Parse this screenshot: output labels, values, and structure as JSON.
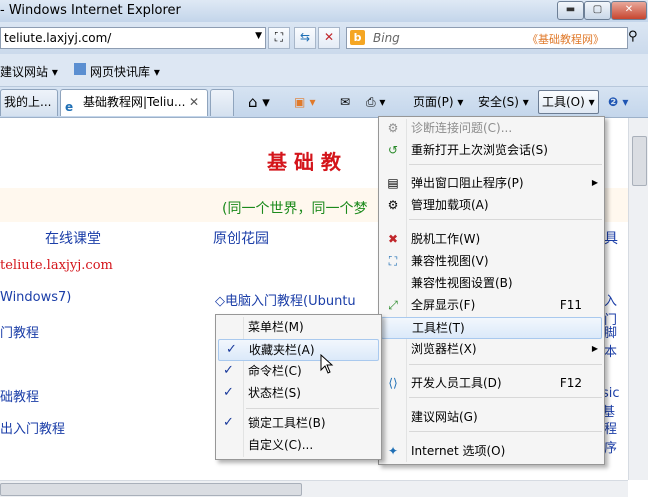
{
  "window": {
    "title": "- Windows Internet Explorer"
  },
  "address": {
    "url": "teliute.laxjyj.com/"
  },
  "search": {
    "provider": "Bing",
    "site_label": "《基础教程网》"
  },
  "favorites_bar": {
    "items": [
      "建议网站 ▾",
      "网页快讯库 ▾"
    ]
  },
  "tabs": [
    {
      "label": "我的上..."
    },
    {
      "label": "基础教程网|Teliu..."
    }
  ],
  "commands": {
    "page": "页面(P)",
    "safety": "安全(S)",
    "tools": "工具(O)"
  },
  "content": {
    "heading": "基  础  教",
    "subtitle": "(同一个世界，同一个梦",
    "nav": [
      "在线课堂",
      "原创花园",
      "具"
    ],
    "domain": "teliute.laxjyj.com",
    "rows": [
      "Windows7)",
      "◇电脑入门教程(Ubuntu",
      "入门",
      "门教程",
      "脚本",
      "础教程",
      "sic基",
      "出入门教程",
      "程序"
    ]
  },
  "tools_menu": {
    "items": [
      {
        "label": "诊断连接问题(C)...",
        "icon": "diagnose-icon",
        "disabled": true
      },
      {
        "label": "重新打开上次浏览会话(S)",
        "icon": "reopen-session-icon"
      },
      {
        "label": "弹出窗口阻止程序(P)",
        "icon": "popup-blocker-icon",
        "submenu": true
      },
      {
        "label": "管理加载项(A)",
        "icon": "addons-icon"
      },
      {
        "label": "脱机工作(W)",
        "icon": "offline-icon"
      },
      {
        "label": "兼容性视图(V)",
        "icon": "compat-view-icon"
      },
      {
        "label": "兼容性视图设置(B)"
      },
      {
        "label": "全屏显示(F)",
        "icon": "fullscreen-icon",
        "accel": "F11"
      },
      {
        "label": "工具栏(T)",
        "highlighted": true
      },
      {
        "label": "浏览器栏(X)",
        "submenu": true
      },
      {
        "label": "开发人员工具(D)",
        "icon": "dev-tools-icon",
        "accel": "F12"
      },
      {
        "label": "建议网站(G)"
      },
      {
        "label": "Internet 选项(O)",
        "icon": "internet-options-icon"
      }
    ]
  },
  "toolbars_submenu": {
    "items": [
      {
        "label": "菜单栏(M)",
        "checked": false
      },
      {
        "label": "收藏夹栏(A)",
        "checked": true,
        "highlighted": true
      },
      {
        "label": "命令栏(C)",
        "checked": true
      },
      {
        "label": "状态栏(S)",
        "checked": true
      },
      {
        "label": "锁定工具栏(B)",
        "checked": true
      },
      {
        "label": "自定义(C)...",
        "checked": false
      }
    ]
  }
}
